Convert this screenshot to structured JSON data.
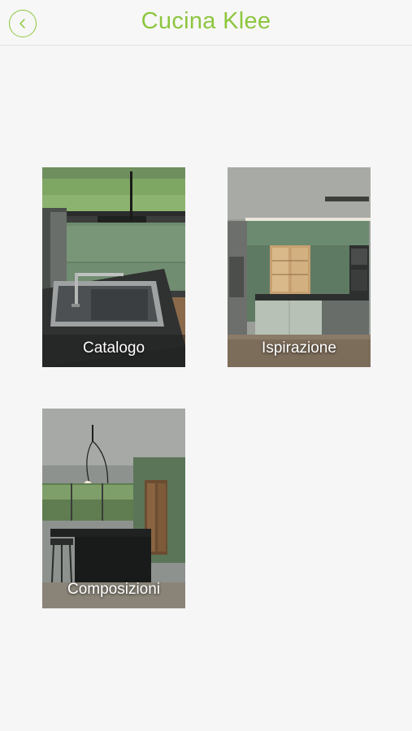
{
  "header": {
    "title": "Cucina Klee",
    "back_icon": "chevron-left-icon",
    "accent_color": "#8dc63f"
  },
  "tiles": [
    {
      "label": "Catalogo"
    },
    {
      "label": "Ispirazione"
    },
    {
      "label": "Composizioni"
    }
  ]
}
